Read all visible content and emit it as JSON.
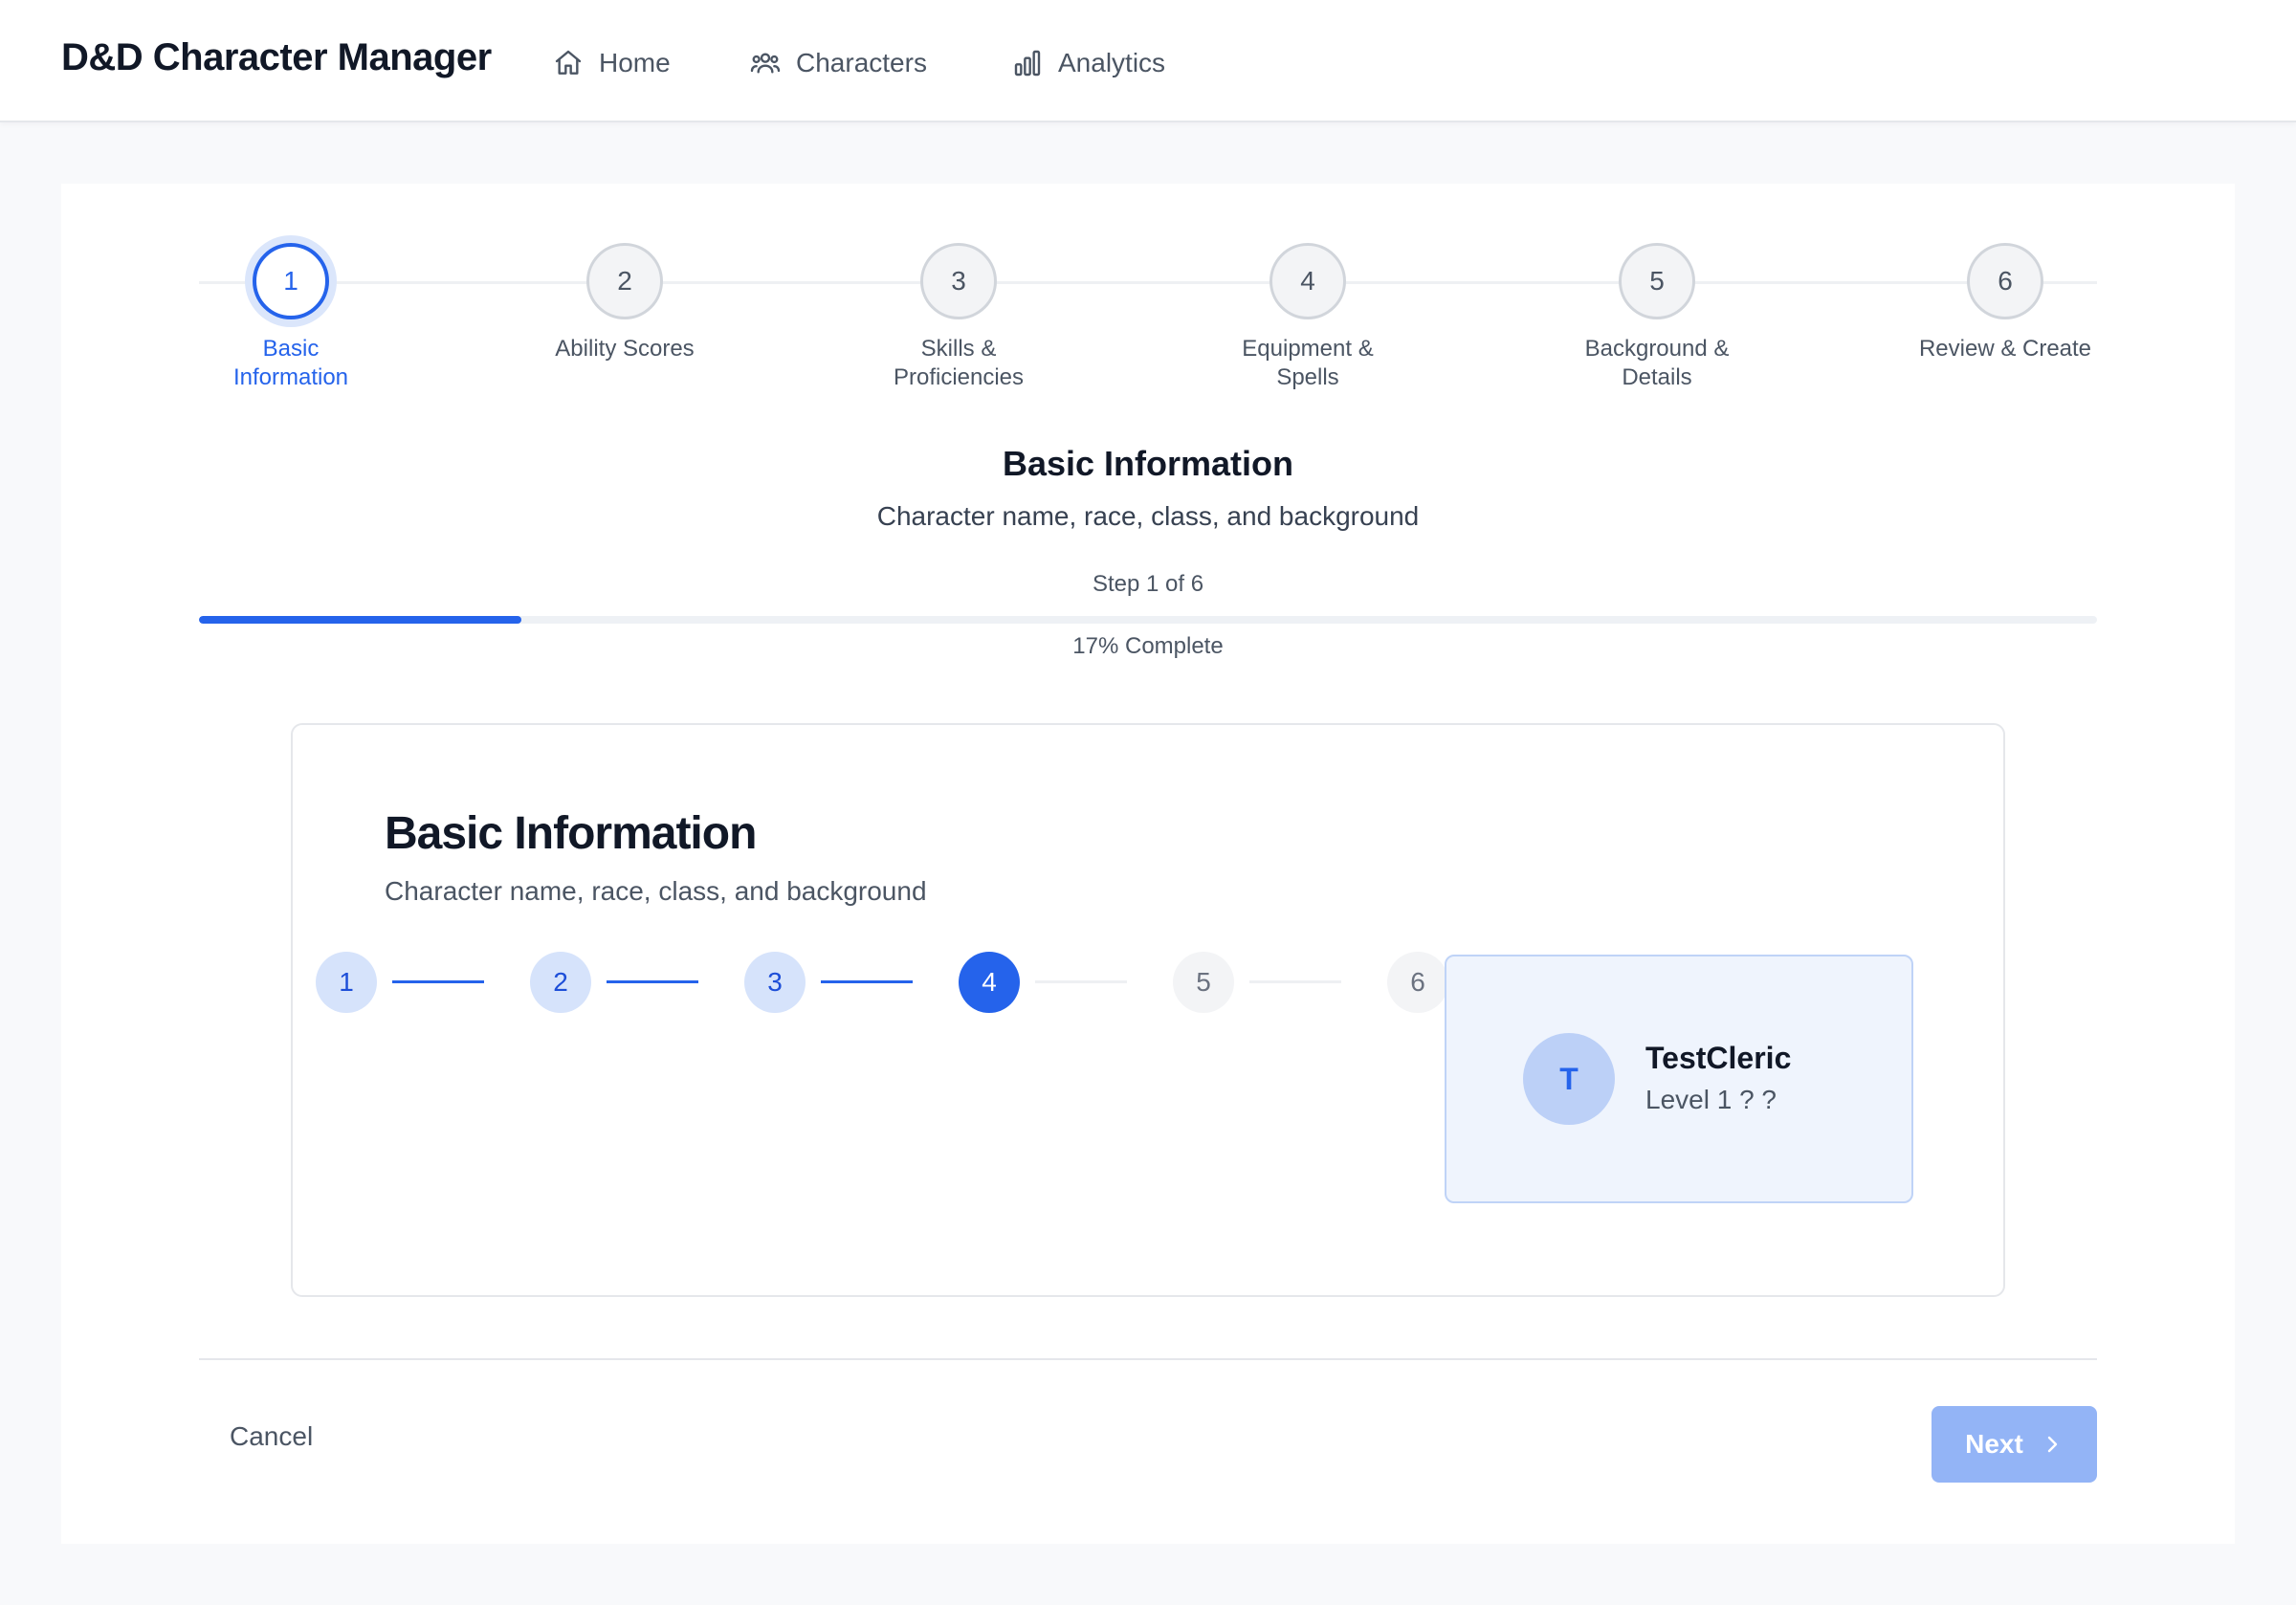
{
  "app": {
    "title": "D&D Character Manager"
  },
  "nav": [
    {
      "label": "Home",
      "icon": "home-icon"
    },
    {
      "label": "Characters",
      "icon": "users-icon"
    },
    {
      "label": "Analytics",
      "icon": "bar-chart-icon"
    }
  ],
  "wizard": {
    "steps": [
      {
        "number": "1",
        "label": "Basic Information",
        "state": "active"
      },
      {
        "number": "2",
        "label": "Ability Scores",
        "state": "pending"
      },
      {
        "number": "3",
        "label": "Skills & Proficiencies",
        "state": "pending"
      },
      {
        "number": "4",
        "label": "Equipment & Spells",
        "state": "pending"
      },
      {
        "number": "5",
        "label": "Background & Details",
        "state": "pending"
      },
      {
        "number": "6",
        "label": "Review & Create",
        "state": "pending"
      }
    ],
    "current_title": "Basic Information",
    "current_subtitle": "Character name, race, class, and background",
    "step_count": "Step 1 of 6",
    "progress_fraction": 0.17,
    "progress_text": "17% Complete"
  },
  "form_card": {
    "title": "Basic Information",
    "subtitle": "Character name, race, class, and background",
    "mini_steps": [
      {
        "number": "1",
        "state": "done"
      },
      {
        "number": "2",
        "state": "done"
      },
      {
        "number": "3",
        "state": "done"
      },
      {
        "number": "4",
        "state": "current"
      },
      {
        "number": "5",
        "state": "todo"
      },
      {
        "number": "6",
        "state": "todo"
      }
    ],
    "preview": {
      "avatar_initial": "T",
      "name": "TestCleric",
      "meta": "Level 1 ? ?"
    }
  },
  "footer": {
    "cancel_label": "Cancel",
    "next_label": "Next"
  },
  "colors": {
    "accent": "#2563eb",
    "next_disabled": "#93b4f6"
  }
}
